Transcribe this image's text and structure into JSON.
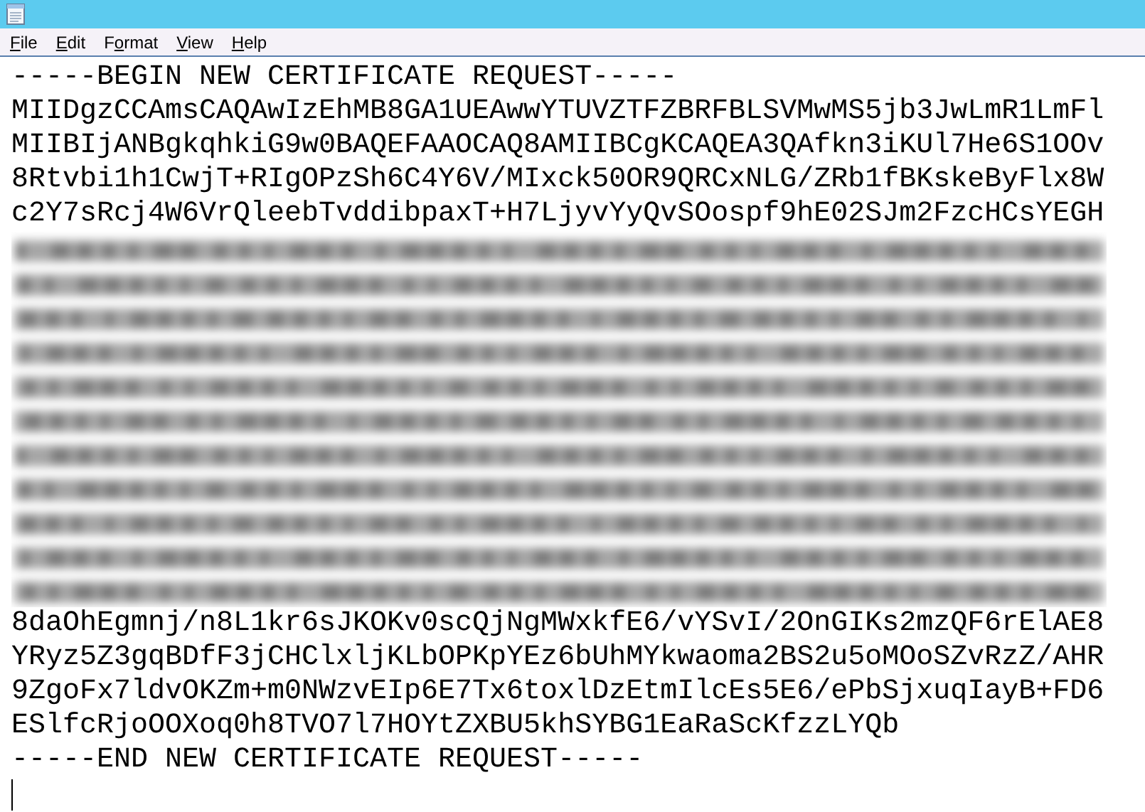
{
  "menu": [
    {
      "access_key": "F",
      "after": "ile"
    },
    {
      "access_key": "E",
      "after": "dit"
    },
    {
      "before": "F",
      "access_key": "o",
      "after": "rmat"
    },
    {
      "access_key": "V",
      "after": "iew"
    },
    {
      "access_key": "H",
      "after": "elp"
    }
  ],
  "document": {
    "lines": [
      {
        "kind": "text",
        "text": "-----BEGIN NEW CERTIFICATE REQUEST-----"
      },
      {
        "kind": "text",
        "text": "MIIDgzCCAmsCAQAwIzEhMB8GA1UEAwwYTUVZTFZBRFBLSVMwMS5jb3JwLmR1LmFl"
      },
      {
        "kind": "text",
        "text": "MIIBIjANBgkqhkiG9w0BAQEFAAOCAQ8AMIIBCgKCAQEA3QAfkn3iKUl7He6S1OOv"
      },
      {
        "kind": "text",
        "text": "8Rtvbi1h1CwjT+RIgOPzSh6C4Y6V/MIxck50OR9QRCxNLG/ZRb1fBKskeByFlx8W"
      },
      {
        "kind": "text",
        "text": "c2Y7sRcj4W6VrQleebTvddibpaxT+H7LjyvYyQvSOospf9hE02SJm2FzcHCsYEGH"
      },
      {
        "kind": "blurred"
      },
      {
        "kind": "text",
        "text": "8daOhEgmnj/n8L1kr6sJKOKv0scQjNgMWxkfE6/vYSvI/2OnGIKs2mzQF6rElAE8"
      },
      {
        "kind": "text",
        "text": "YRyz5Z3gqBDfF3jCHClxljKLbOPKpYEz6bUhMYkwaoma2BS2u5oMOoSZvRzZ/AHR"
      },
      {
        "kind": "text",
        "text": "9ZgoFx7ldvOKZm+m0NWzvEIp6E7Tx6toxlDzEtmIlcEs5E6/ePbSjxuqIayB+FD6"
      },
      {
        "kind": "text",
        "text": "ESlfcRjoOOXoq0h8TVO7l7HOYtZXBU5khSYBG1EaRaScKfzzLYQb"
      },
      {
        "kind": "text",
        "text": "-----END NEW CERTIFICATE REQUEST-----"
      },
      {
        "kind": "caret"
      }
    ]
  }
}
